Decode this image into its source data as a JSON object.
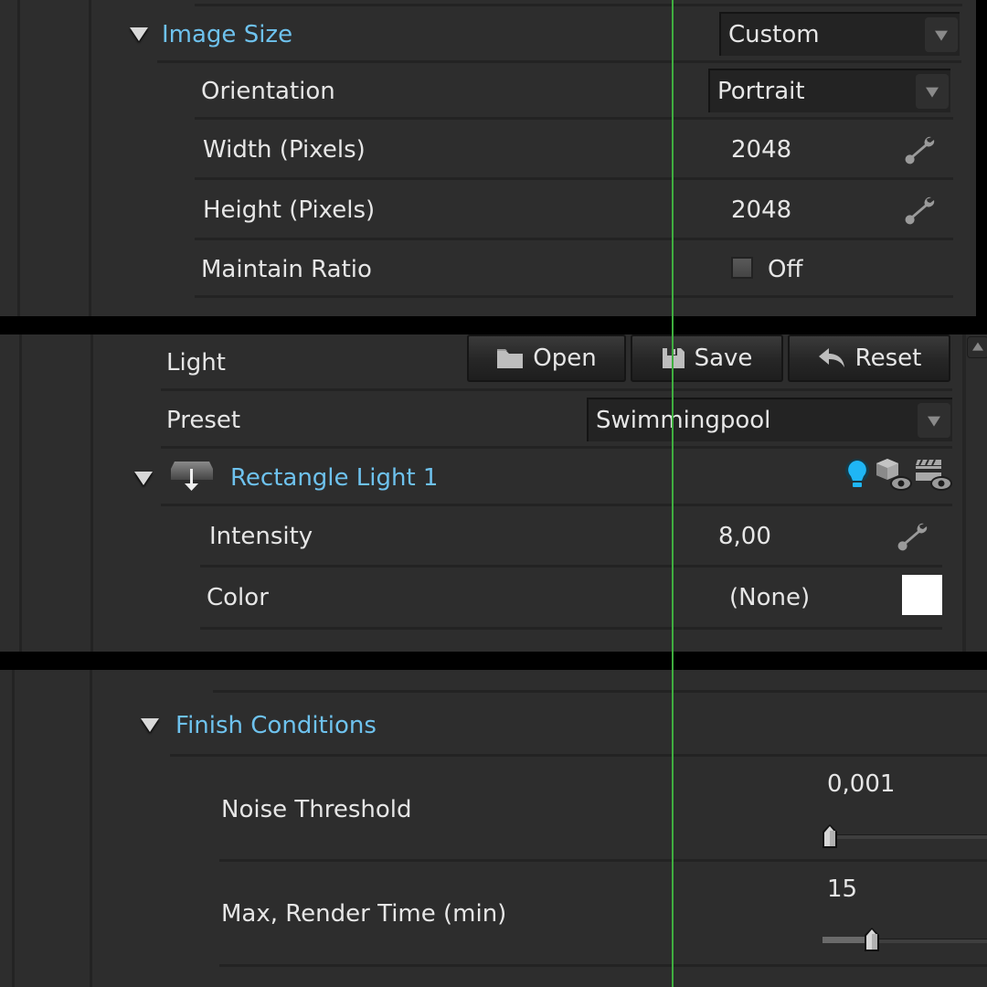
{
  "panel1": {
    "section": {
      "label": "Image Size",
      "value": "Custom"
    },
    "rows": [
      {
        "label": "Orientation",
        "value": "Portrait",
        "control": "dropdown"
      },
      {
        "label": "Width (Pixels)",
        "value": "2048",
        "control": "wrench"
      },
      {
        "label": "Height (Pixels)",
        "value": "2048",
        "control": "wrench"
      },
      {
        "label": "Maintain Ratio",
        "value": "Off",
        "control": "checkbox",
        "checked": false
      }
    ]
  },
  "panel2": {
    "light_row": {
      "label": "Light",
      "buttons": [
        {
          "label": "Open",
          "icon": "folder-icon"
        },
        {
          "label": "Save",
          "icon": "floppy-disk-icon"
        },
        {
          "label": "Reset",
          "icon": "undo-arrow-icon"
        }
      ]
    },
    "preset_row": {
      "label": "Preset",
      "value": "Swimmingpool"
    },
    "light_group": {
      "label": "Rectangle Light 1",
      "icons": [
        "lightbulb-icon",
        "object-visibility-icon",
        "render-visibility-icon"
      ],
      "accent": "#1fb6f5"
    },
    "rows": [
      {
        "label": "Intensity",
        "value": "8,00",
        "control": "wrench"
      },
      {
        "label": "Color",
        "value": "(None)",
        "swatch": "#ffffff"
      }
    ]
  },
  "panel3": {
    "section": {
      "label": "Finish Conditions"
    },
    "rows": [
      {
        "label": "Noise Threshold",
        "value": "0,001",
        "slider_fraction": 0.0
      },
      {
        "label": "Max, Render Time (min)",
        "value": "15",
        "slider_fraction": 0.2
      }
    ]
  },
  "colors": {
    "heading": "#6ec2ee",
    "background": "#2d2d2d",
    "guide": "#3fae3f"
  }
}
